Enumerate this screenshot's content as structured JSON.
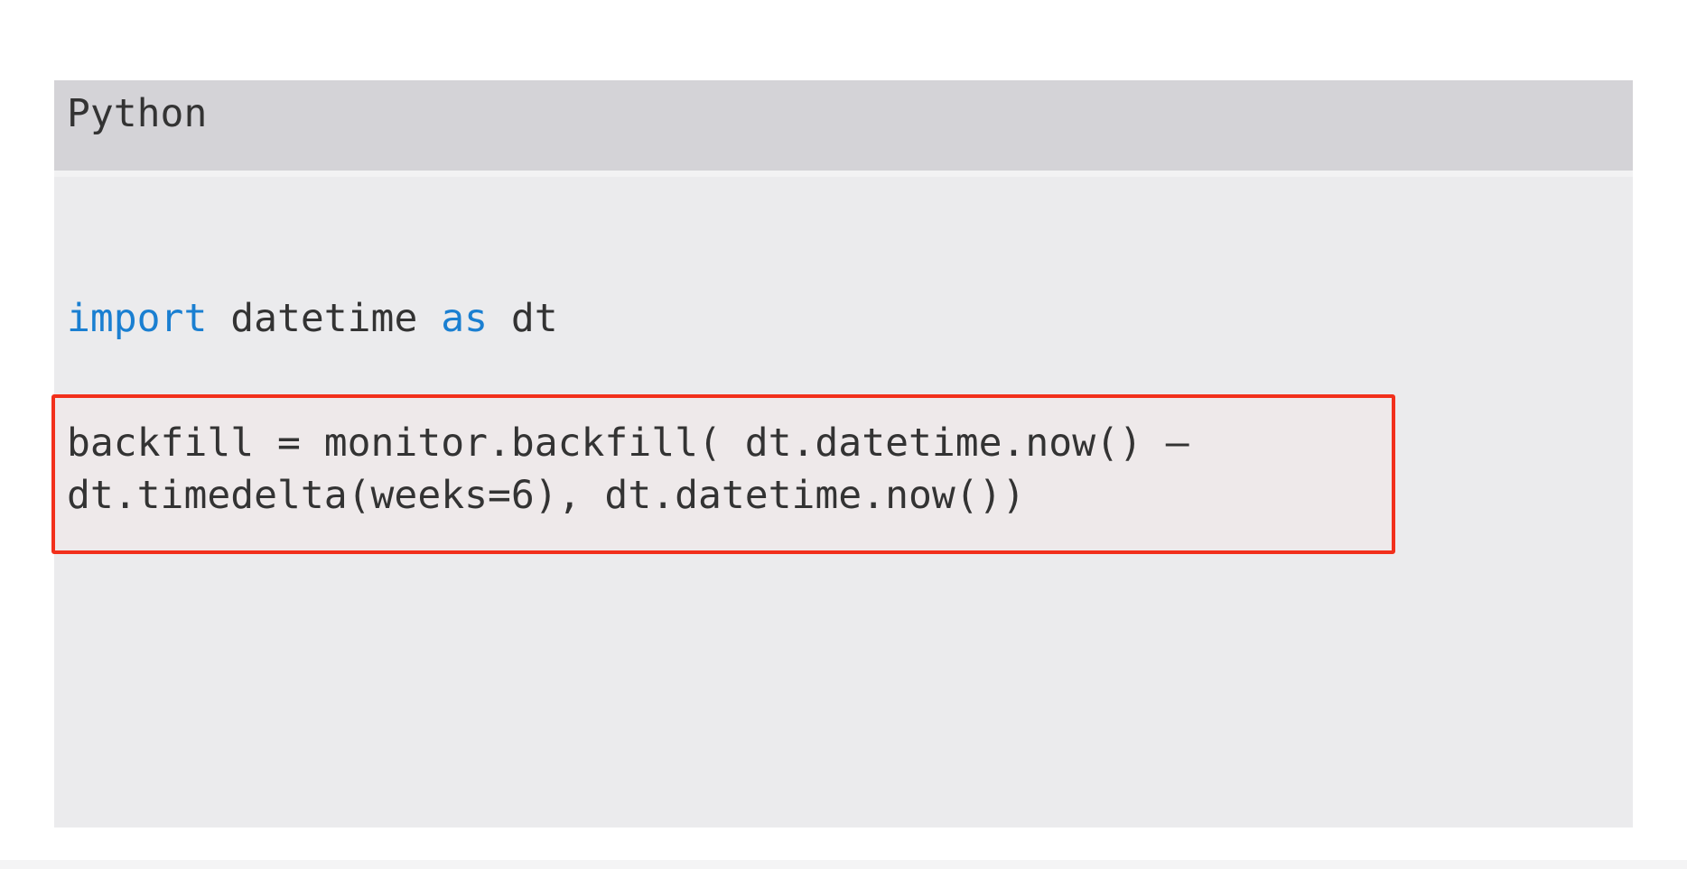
{
  "code_block": {
    "language_label": "Python",
    "import_line": {
      "keyword_import": "import",
      "module": " datetime ",
      "keyword_as": "as",
      "alias": " dt"
    },
    "highlighted_statement": {
      "line1": "backfill = monitor.backfill( dt.datetime.now() –",
      "line2": "dt.timedelta(weeks=6), dt.datetime.now())"
    }
  },
  "colors": {
    "header_bg": "#d4d3d7",
    "body_bg": "#ebebed",
    "keyword": "#1a7fd1",
    "text": "#333333",
    "highlight_border": "#f2301c"
  }
}
